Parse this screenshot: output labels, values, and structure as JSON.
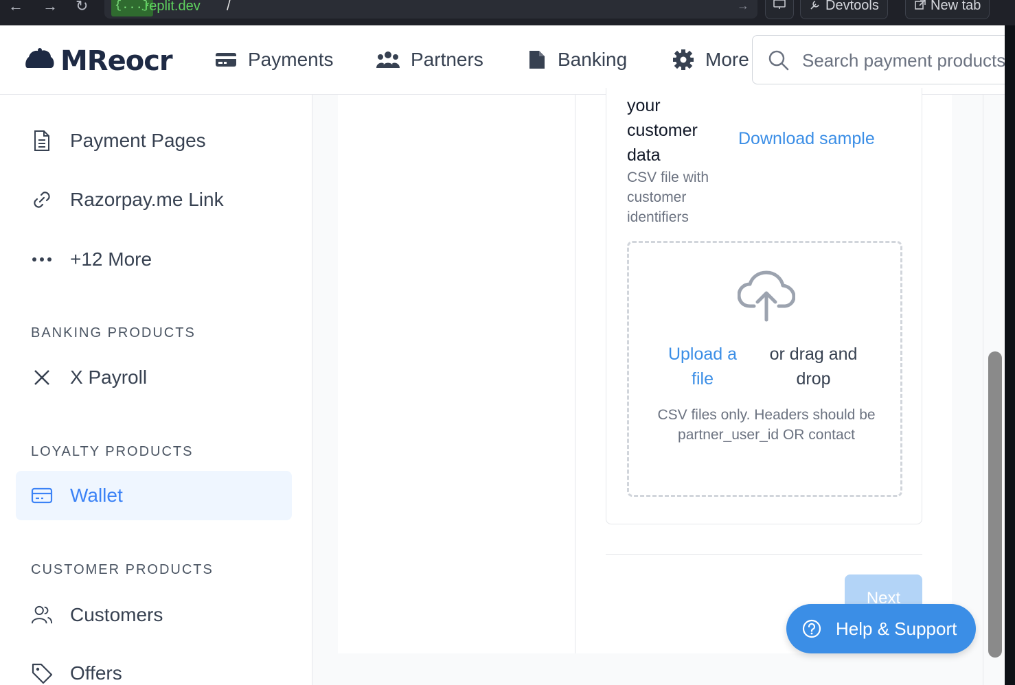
{
  "browser": {
    "url_tag": "{...}",
    "url_host": ".replit.dev",
    "url_path": "/",
    "devtools_label": "Devtools",
    "newtab_label": "New tab"
  },
  "brand": {
    "name": "MReocr"
  },
  "topnav": {
    "items": [
      {
        "label": "Payments",
        "icon": "credit-card-icon"
      },
      {
        "label": "Partners",
        "icon": "users-icon"
      },
      {
        "label": "Banking",
        "icon": "document-icon"
      },
      {
        "label": "More",
        "icon": "gear-icon"
      }
    ],
    "search_placeholder": "Search payment products"
  },
  "sidebar": {
    "items": [
      {
        "label": "Payment Pages",
        "icon": "document-text-icon"
      },
      {
        "label": "Razorpay.me Link",
        "icon": "link-icon"
      },
      {
        "label": "+12 More",
        "icon": "ellipsis-icon"
      }
    ],
    "banking_heading": "BANKING PRODUCTS",
    "banking_items": [
      {
        "label": "X Payroll",
        "icon": "x-icon"
      }
    ],
    "loyalty_heading": "LOYALTY PRODUCTS",
    "loyalty_items": [
      {
        "label": "Wallet",
        "icon": "wallet-icon",
        "active": true
      }
    ],
    "customer_heading": "CUSTOMER PRODUCTS",
    "customer_items": [
      {
        "label": "Customers",
        "icon": "users-outline-icon"
      },
      {
        "label": "Offers",
        "icon": "tag-icon"
      }
    ]
  },
  "upload": {
    "label": "your customer data",
    "sublabel": "CSV file with customer identifiers",
    "download_link": "Download sample",
    "upload_link": "Upload a file",
    "drag_text": "or drag and drop",
    "note": "CSV files only. Headers should be partner_user_id OR contact"
  },
  "actions": {
    "next_label": "Next"
  },
  "help": {
    "label": "Help & Support"
  },
  "colors": {
    "accent": "#3b8ee6",
    "active_bg": "#eff6ff"
  }
}
